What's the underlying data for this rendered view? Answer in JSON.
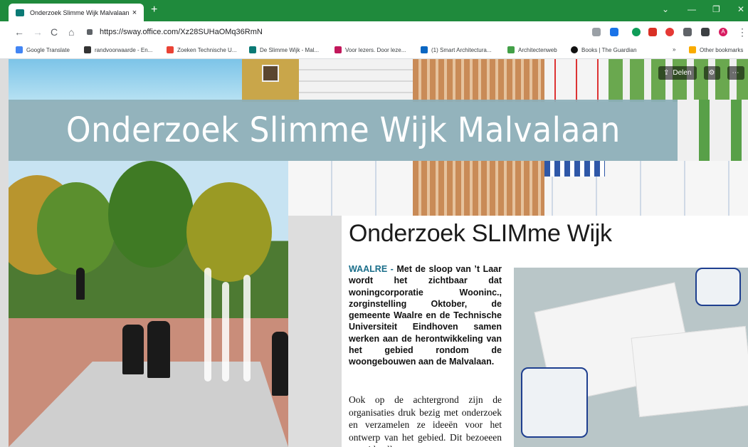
{
  "browser": {
    "tab_title": "Onderzoek Slimme Wijk Malvalaan",
    "tab_close": "×",
    "new_tab": "+",
    "url": "https://sway.office.com/Xz28SUHaOMq36RmN",
    "profile_initial": "A"
  },
  "bookmarks": [
    "Google Translate",
    "randvoorwaarde - En...",
    "Zoeken Technische U...",
    "De Slimme Wijk - Mal...",
    "Voor lezers. Door leze...",
    "(1) Smart Architectura...",
    "Architectenweb",
    "Books | The Guardian",
    "»",
    "Other bookmarks"
  ],
  "sway": {
    "share_label": "Delen",
    "banner_title": "Onderzoek Slimme Wijk Malvalaan"
  },
  "article": {
    "headline": "Onderzoek SLIMme Wijk",
    "lead_place": "WAALRE -",
    "lead_text": " Met de sloop van ’t Laar wordt het zichtbaar dat woningcorporatie Wooninc., zorginstelling Oktober, de gemeente Waalre en de Technische Universiteit Eindhoven samen werken aan de herontwikkeling van het gebied rondom de woongebouwen aan de Malvalaan.",
    "body_text": "Ook op de achtergrond zijn de organisaties druk bezig met onderzoek en verzamelen ze ideeën voor het ontwerp van het gebied. Dit bezoeeen over idn elln"
  },
  "colors": {
    "tabbar": "#1f8a3c",
    "banner": "#8cafb9",
    "lead_place": "#1a6e8a"
  }
}
